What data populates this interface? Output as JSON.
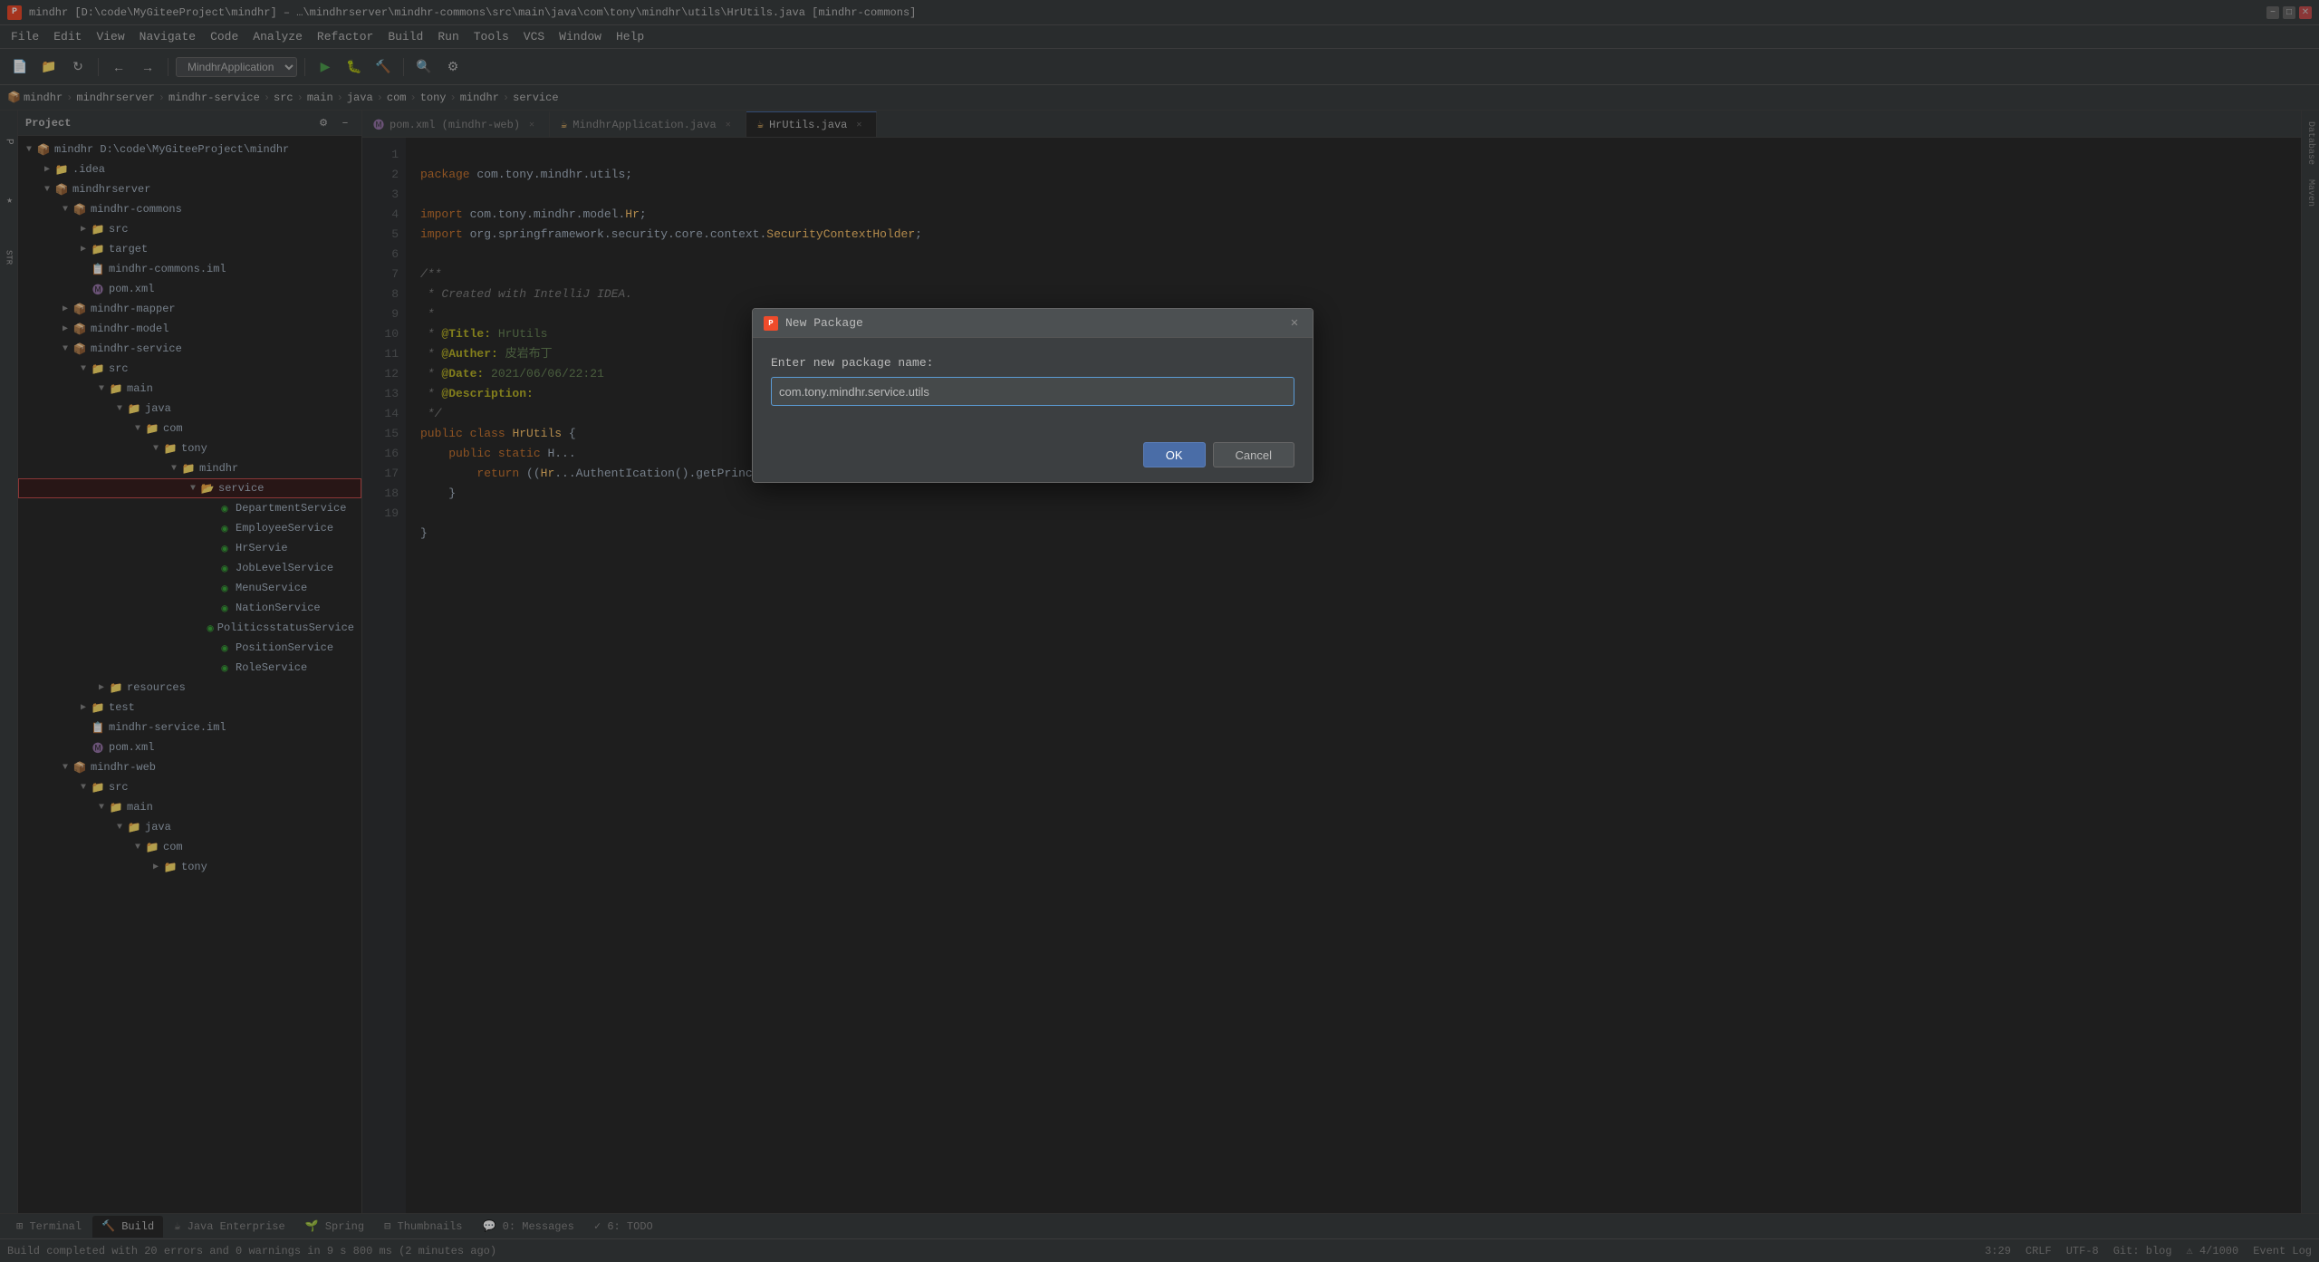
{
  "titlebar": {
    "title": "mindhr [D:\\code\\MyGiteeProject\\mindhr] – …\\mindhrserver\\mindhr-commons\\src\\main\\java\\com\\tony\\mindhr\\utils\\HrUtils.java [mindhr-commons]",
    "app_icon": "P"
  },
  "menu": {
    "items": [
      "File",
      "Edit",
      "View",
      "Navigate",
      "Code",
      "Analyze",
      "Refactor",
      "Build",
      "Run",
      "Tools",
      "VCS",
      "Window",
      "Help"
    ]
  },
  "toolbar": {
    "branch": "MindhrApplication"
  },
  "breadcrumb": {
    "items": [
      "mindhr",
      "mindhrserver",
      "mindhr-service",
      "src",
      "main",
      "java",
      "com",
      "tony",
      "mindhr",
      "service"
    ]
  },
  "editor": {
    "tabs": [
      {
        "label": "pom.xml (mindhr-web)",
        "active": false,
        "icon": "xml"
      },
      {
        "label": "MindhrApplication.java",
        "active": false,
        "icon": "java"
      },
      {
        "label": "HrUtils.java",
        "active": true,
        "icon": "java"
      }
    ],
    "filename": "HrUtils.java"
  },
  "project": {
    "title": "Project",
    "root": {
      "label": "mindhr",
      "path": "D:\\code\\MyGiteeProject\\mindhr",
      "children": [
        {
          "label": ".idea",
          "type": "folder",
          "level": 1
        },
        {
          "label": "mindhrserver",
          "type": "module",
          "level": 1,
          "children": [
            {
              "label": "mindhr-commons",
              "type": "module",
              "level": 2,
              "children": [
                {
                  "label": "src",
                  "type": "folder",
                  "level": 3
                },
                {
                  "label": "target",
                  "type": "folder",
                  "level": 3
                },
                {
                  "label": "mindhr-commons.iml",
                  "type": "iml",
                  "level": 3
                },
                {
                  "label": "pom.xml",
                  "type": "xml",
                  "level": 3
                }
              ]
            },
            {
              "label": "mindhr-mapper",
              "type": "module",
              "level": 2
            },
            {
              "label": "mindhr-model",
              "type": "module",
              "level": 2
            },
            {
              "label": "mindhr-service",
              "type": "module",
              "level": 2,
              "children": [
                {
                  "label": "src",
                  "type": "folder",
                  "level": 3,
                  "children": [
                    {
                      "label": "main",
                      "type": "folder",
                      "level": 4,
                      "children": [
                        {
                          "label": "java",
                          "type": "folder",
                          "level": 5,
                          "children": [
                            {
                              "label": "com",
                              "type": "folder",
                              "level": 6,
                              "children": [
                                {
                                  "label": "tony",
                                  "type": "folder",
                                  "level": 7,
                                  "children": [
                                    {
                                      "label": "mindhr",
                                      "type": "folder",
                                      "level": 8,
                                      "children": [
                                        {
                                          "label": "service",
                                          "type": "folder-open",
                                          "level": 9,
                                          "selected": true,
                                          "children": [
                                            {
                                              "label": "DepartmentService",
                                              "type": "java-interface",
                                              "level": 10
                                            },
                                            {
                                              "label": "EmployeeService",
                                              "type": "java-interface",
                                              "level": 10
                                            },
                                            {
                                              "label": "HrServie",
                                              "type": "java-interface",
                                              "level": 10
                                            },
                                            {
                                              "label": "JobLevelService",
                                              "type": "java-interface",
                                              "level": 10
                                            },
                                            {
                                              "label": "MenuService",
                                              "type": "java-interface",
                                              "level": 10
                                            },
                                            {
                                              "label": "NationService",
                                              "type": "java-interface",
                                              "level": 10
                                            },
                                            {
                                              "label": "PoliticsstatusService",
                                              "type": "java-interface",
                                              "level": 10
                                            },
                                            {
                                              "label": "PositionService",
                                              "type": "java-interface",
                                              "level": 10
                                            },
                                            {
                                              "label": "RoleService",
                                              "type": "java-interface",
                                              "level": 10
                                            }
                                          ]
                                        }
                                      ]
                                    }
                                  ]
                                }
                              ]
                            }
                          ]
                        }
                      ]
                    },
                    {
                      "label": "resources",
                      "type": "folder",
                      "level": 4
                    }
                  ]
                },
                {
                  "label": "test",
                  "type": "folder",
                  "level": 3
                },
                {
                  "label": "mindhr-service.iml",
                  "type": "iml",
                  "level": 3
                },
                {
                  "label": "pom.xml",
                  "type": "xml",
                  "level": 3
                }
              ]
            },
            {
              "label": "mindhr-web",
              "type": "module",
              "level": 2,
              "children": [
                {
                  "label": "src",
                  "type": "folder",
                  "level": 3,
                  "children": [
                    {
                      "label": "main",
                      "type": "folder",
                      "level": 4,
                      "children": [
                        {
                          "label": "java",
                          "type": "folder",
                          "level": 5,
                          "children": [
                            {
                              "label": "com",
                              "type": "folder",
                              "level": 6,
                              "children": [
                                {
                                  "label": "tony",
                                  "type": "folder",
                                  "level": 7
                                }
                              ]
                            }
                          ]
                        }
                      ]
                    }
                  ]
                }
              ]
            }
          ]
        }
      ]
    }
  },
  "code": {
    "lines": [
      {
        "num": 1,
        "text": "package com.tony.mindhr.utils;"
      },
      {
        "num": 2,
        "text": ""
      },
      {
        "num": 3,
        "text": "import com.tony.mindhr.model.Hr;"
      },
      {
        "num": 4,
        "text": "import org.springframework.security.core.context.SecurityContextHolder;"
      },
      {
        "num": 5,
        "text": ""
      },
      {
        "num": 6,
        "text": "/**"
      },
      {
        "num": 7,
        "text": " * Created with IntelliJ IDEA."
      },
      {
        "num": 8,
        "text": " *"
      },
      {
        "num": 9,
        "text": " * @Title: HrUtils"
      },
      {
        "num": 10,
        "text": " * @Auther: 皮岩布丁"
      },
      {
        "num": 11,
        "text": " * @Date: 2021/06/06/22:21"
      },
      {
        "num": 12,
        "text": " * @Description:"
      },
      {
        "num": 13,
        "text": " */"
      },
      {
        "num": 14,
        "text": "public class HrUtils {"
      },
      {
        "num": 15,
        "text": "    public static H..."
      },
      {
        "num": 16,
        "text": "        return ((Hr...AuthentIcation().getPrincipal());"
      },
      {
        "num": 17,
        "text": "    }"
      },
      {
        "num": 18,
        "text": ""
      },
      {
        "num": 19,
        "text": "}"
      }
    ]
  },
  "dialog": {
    "title": "New Package",
    "label": "Enter new package name:",
    "input_value": "com.tony.mindhr.service.utils",
    "ok_label": "OK",
    "cancel_label": "Cancel"
  },
  "bottom_tabs": {
    "items": [
      "Terminal",
      "Build",
      "Java Enterprise",
      "Spring",
      "Thumbnails",
      "Messages",
      "TODO"
    ]
  },
  "status": {
    "message": "Build completed with 20 errors and 0 warnings in 9 s 800 ms (2 minutes ago)",
    "position": "3:29",
    "encoding": "CRLF",
    "charset": "UTF-8",
    "line_sep": "Git: blog",
    "right": "3:29  CRLF  UTF-8  Git: blog  ⚠ 4/1000"
  }
}
